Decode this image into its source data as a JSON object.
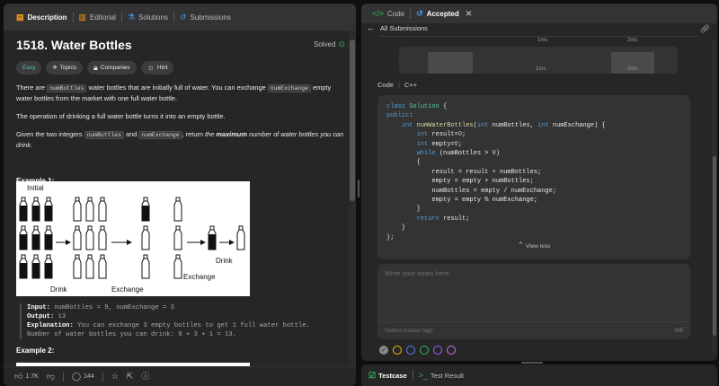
{
  "left_tabs": [
    {
      "label": "Description",
      "icon": "document-icon",
      "active": true
    },
    {
      "label": "Editorial",
      "icon": "book-icon",
      "active": false
    },
    {
      "label": "Solutions",
      "icon": "flask-icon",
      "active": false
    },
    {
      "label": "Submissions",
      "icon": "history-icon",
      "active": false
    }
  ],
  "problem": {
    "title": "1518. Water Bottles",
    "status": "Solved",
    "tags": [
      {
        "label": "Easy",
        "icon": ""
      },
      {
        "label": "Topics",
        "icon": "tag-icon"
      },
      {
        "label": "Companies",
        "icon": "lock-icon"
      },
      {
        "label": "Hint",
        "icon": "lightbulb-icon"
      }
    ],
    "p1_a": "There are ",
    "p1_code1": "numBottles",
    "p1_b": " water bottles that are initially full of water. You can exchange ",
    "p1_code2": "numExchange",
    "p1_c": " empty water bottles from the market with one full water bottle.",
    "p2": "The operation of drinking a full water bottle turns it into an empty bottle.",
    "p3_a": "Given the two integers ",
    "p3_code1": "numBottles",
    "p3_b": " and ",
    "p3_code2": "numExchange",
    "p3_c": ", return ",
    "p3_d": "the ",
    "p3_e": "maximum",
    "p3_f": " number of water bottles you can drink.",
    "example1_title": "Example 1:",
    "example2_title": "Example 2:",
    "figure_labels": {
      "initial": "Initial",
      "drink1": "Drink",
      "exchange1": "Exchange",
      "exchange2": "Exchange",
      "drink2": "Drink"
    },
    "input_label": "Input:",
    "input_value": " numBottles = 9, numExchange = 3",
    "output_label": "Output:",
    "output_value": " 13",
    "explanation_label": "Explanation:",
    "explanation_value": " You can exchange 3 empty bottles to get 1 full water bottle.",
    "explanation_line2": "Number of water bottles you can drink: 9 + 3 + 1 = 13."
  },
  "left_footer": {
    "likes": "1.7K",
    "comments": "144"
  },
  "right_tabs": [
    {
      "label": "Code",
      "icon": "code-icon",
      "active": false
    },
    {
      "label": "Accepted",
      "icon": "history-icon",
      "active": true
    }
  ],
  "right": {
    "back_label": "All Submissions",
    "chart_ticks_top": [
      "1ms",
      "2ms"
    ],
    "chart_ticks_bottom": [
      "1ms",
      "2ms"
    ],
    "code_label": "Code",
    "lang_label": "C++",
    "view_less": "View less",
    "notes_placeholder": "Write your notes here",
    "tags_placeholder": "Select related tags",
    "tag_count": "0/5"
  },
  "bottom_tabs": [
    {
      "label": "Testcase",
      "icon": "checkbox-icon",
      "active": true
    },
    {
      "label": "Test Result",
      "icon": "terminal-icon",
      "active": false
    }
  ],
  "colors": {
    "accent_green": "#2cbb5d",
    "easy": "#46c6c2",
    "circle_colors": [
      "#888888",
      "#ffb800",
      "#5a7fff",
      "#2cbb5d",
      "#b154ff",
      "#c874ff"
    ]
  }
}
